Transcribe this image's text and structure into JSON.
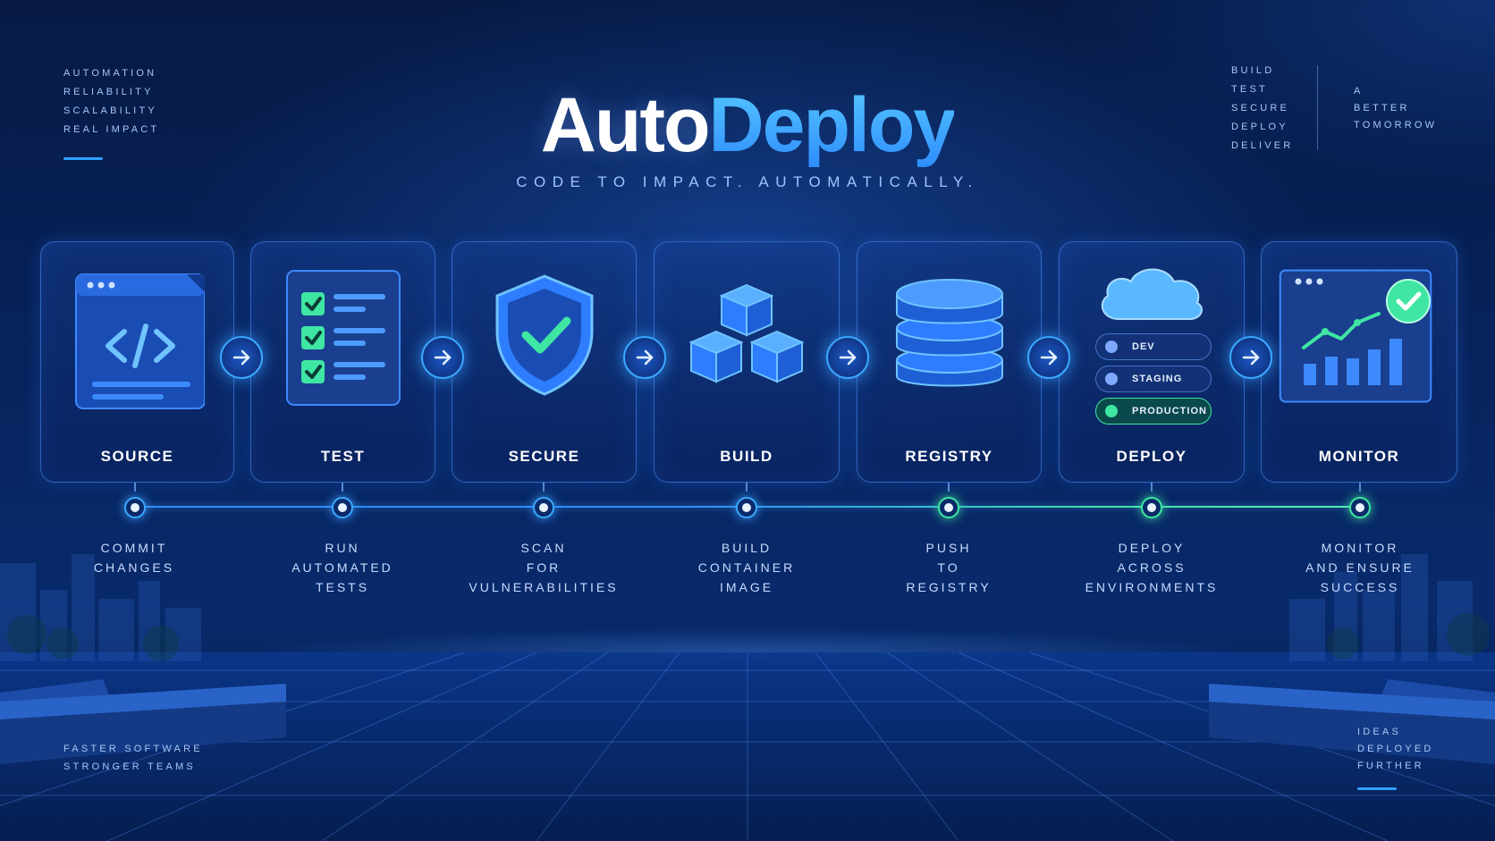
{
  "brand": {
    "title_part1": "Auto",
    "title_part2": "Deploy",
    "tagline": "CODE TO IMPACT. AUTOMATICALLY."
  },
  "corner_top_left": [
    "AUTOMATION",
    "RELIABILITY",
    "SCALABILITY",
    "REAL IMPACT"
  ],
  "corner_top_right_a": [
    "BUILD",
    "TEST",
    "SECURE",
    "DEPLOY",
    "DELIVER"
  ],
  "corner_top_right_b": [
    "A",
    "BETTER",
    "TOMORROW"
  ],
  "corner_bottom_left": [
    "FASTER SOFTWARE",
    "STRONGER TEAMS"
  ],
  "corner_bottom_right": [
    "IDEAS",
    "DEPLOYED",
    "FURTHER"
  ],
  "stages": [
    {
      "label": "SOURCE",
      "icon": "code-window-icon",
      "desc": [
        "COMMIT",
        "CHANGES"
      ]
    },
    {
      "label": "TEST",
      "icon": "checklist-icon",
      "desc": [
        "RUN",
        "AUTOMATED",
        "TESTS"
      ]
    },
    {
      "label": "SECURE",
      "icon": "shield-check-icon",
      "desc": [
        "SCAN",
        "FOR",
        "VULNERABILITIES"
      ]
    },
    {
      "label": "BUILD",
      "icon": "cubes-icon",
      "desc": [
        "BUILD",
        "CONTAINER",
        "IMAGE"
      ]
    },
    {
      "label": "REGISTRY",
      "icon": "database-icon",
      "desc": [
        "PUSH",
        "TO",
        "REGISTRY"
      ]
    },
    {
      "label": "DEPLOY",
      "icon": "cloud-icon",
      "desc": [
        "DEPLOY",
        "ACROSS",
        "ENVIRONMENTS"
      ]
    },
    {
      "label": "MONITOR",
      "icon": "dashboard-chart-icon",
      "desc": [
        "MONITOR",
        "AND ENSURE",
        "SUCCESS"
      ]
    }
  ],
  "environments": [
    "DEV",
    "STAGING",
    "PRODUCTION"
  ],
  "colors": {
    "accent_blue": "#2f8dff",
    "accent_cyan": "#56c8ff",
    "success_green": "#3fe6a3",
    "background": "#061a44"
  }
}
